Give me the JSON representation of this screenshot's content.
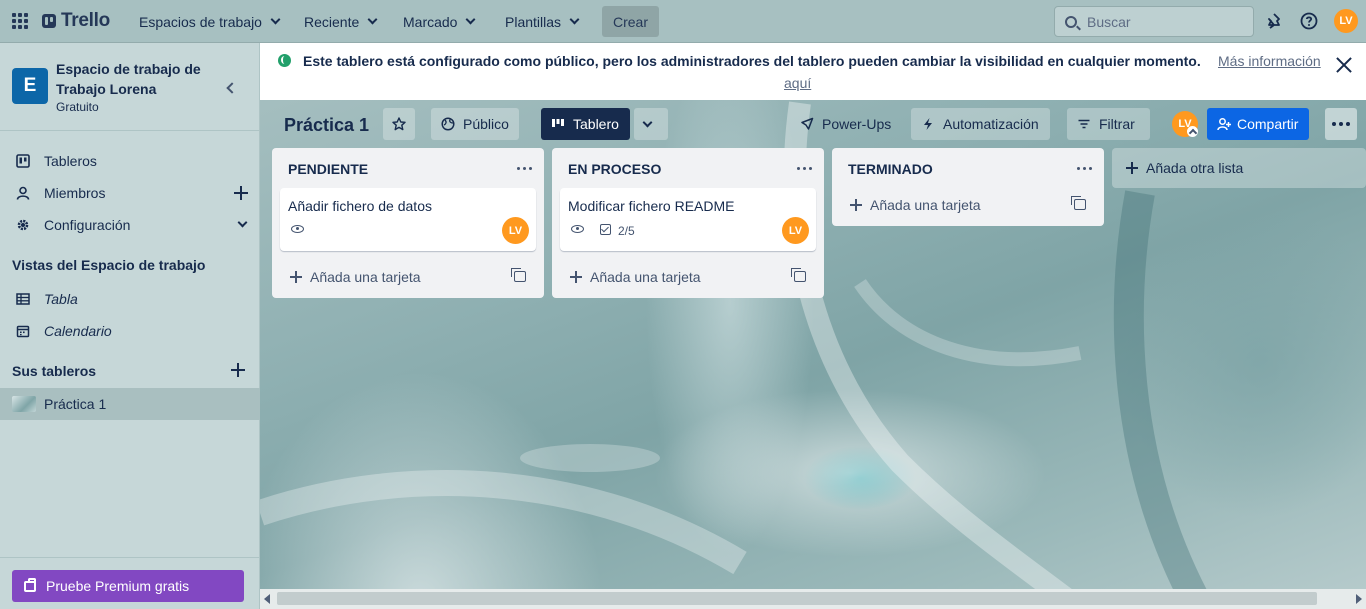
{
  "topnav": {
    "logo": "Trello",
    "menus": [
      "Espacios de trabajo",
      "Reciente",
      "Marcado",
      "Plantillas"
    ],
    "create": "Crear",
    "search_placeholder": "Buscar",
    "user_initials": "LV",
    "icons": [
      "apps-grid-icon",
      "notifications-icon",
      "help-icon"
    ]
  },
  "sidebar": {
    "workspace_initial": "E",
    "workspace_name": "Espacio de trabajo de Trabajo Lorena",
    "workspace_plan": "Gratuito",
    "items": [
      {
        "label": "Tableros",
        "icon": "board-icon"
      },
      {
        "label": "Miembros",
        "icon": "member-icon"
      },
      {
        "label": "Configuración",
        "icon": "gear-icon"
      }
    ],
    "views_heading": "Vistas del Espacio de trabajo",
    "views": [
      {
        "label": "Tabla",
        "icon": "table-icon"
      },
      {
        "label": "Calendario",
        "icon": "calendar-icon"
      }
    ],
    "boards_heading": "Sus tableros",
    "boards": [
      {
        "label": "Práctica 1"
      }
    ],
    "premium": "Pruebe Premium gratis"
  },
  "notice": {
    "text": "Este tablero está configurado como público, pero los administradores del tablero pueden cambiar la visibilidad en cualquier momento.",
    "link_part1": "Más información",
    "link_part2": "aquí"
  },
  "board_header": {
    "title": "Práctica 1",
    "visibility": "Público",
    "view": "Tablero",
    "power_ups": "Power-Ups",
    "automation": "Automatización",
    "filter": "Filtrar",
    "member_initials": "LV",
    "share": "Compartir"
  },
  "lists": [
    {
      "title": "PENDIENTE",
      "cards": [
        {
          "title": "Añadir fichero de datos",
          "watching": true,
          "member": "LV"
        }
      ],
      "add_card": "Añada una tarjeta"
    },
    {
      "title": "EN PROCESO",
      "cards": [
        {
          "title": "Modificar fichero README",
          "watching": true,
          "checklist": "2/5",
          "member": "LV"
        }
      ],
      "add_card": "Añada una tarjeta"
    },
    {
      "title": "TERMINADO",
      "cards": [],
      "add_card": "Añada una tarjeta"
    }
  ],
  "add_list": "Añada otra lista",
  "colors": {
    "accent_blue": "#0c66e4",
    "avatar_orange": "#ff991f",
    "premium_purple": "#8248c2",
    "workspace_blue": "#0c66a8"
  }
}
